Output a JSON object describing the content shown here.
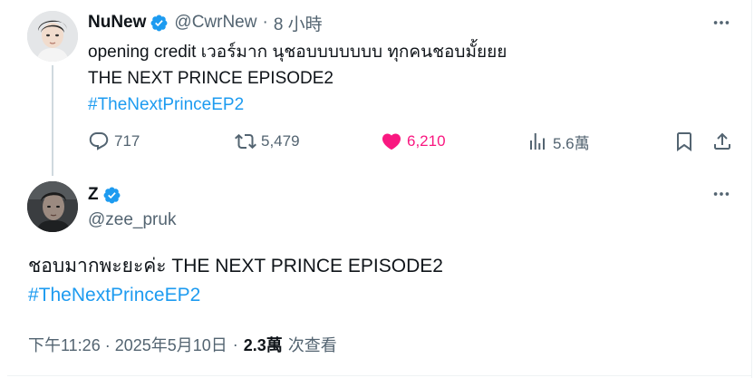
{
  "parent_tweet": {
    "author_name": "NuNew",
    "handle": "@CwrNew",
    "separator": "·",
    "time_ago": "8 小時",
    "text_line_1": "opening credit เวอร์มาก นุชอบบบบบบบ ทุกคนชอบมั้ยยย",
    "text_line_2": "THE NEXT PRINCE EPISODE2",
    "hashtag": "#TheNextPrinceEP2",
    "stats": {
      "replies": "717",
      "retweets": "5,479",
      "likes": "6,210",
      "views": "5.6萬"
    },
    "avatar_icon": "portrait-avatar"
  },
  "main_tweet": {
    "author_name": "Z",
    "handle": "@zee_pruk",
    "text_line_1": "ชอบมากพะยะค่ะ THE NEXT PRINCE EPISODE2",
    "hashtag": "#TheNextPrinceEP2",
    "timestamp": "下午11:26 · 2025年5月10日",
    "separator": "·",
    "views_count": "2.3萬",
    "views_label": "次查看",
    "avatar_icon": "portrait-avatar"
  },
  "colors": {
    "accent": "#1d9bf0",
    "like_active": "#f91880",
    "secondary_text": "#536471",
    "primary_text": "#0f1419",
    "thread_line": "#cfd9de"
  },
  "icons": {
    "verified": "verified-badge-icon",
    "more": "more-dots-icon",
    "reply": "reply-bubble-icon",
    "retweet": "retweet-icon",
    "like": "heart-filled-icon",
    "views": "bar-chart-icon",
    "bookmark": "bookmark-icon",
    "share": "share-upload-icon"
  }
}
